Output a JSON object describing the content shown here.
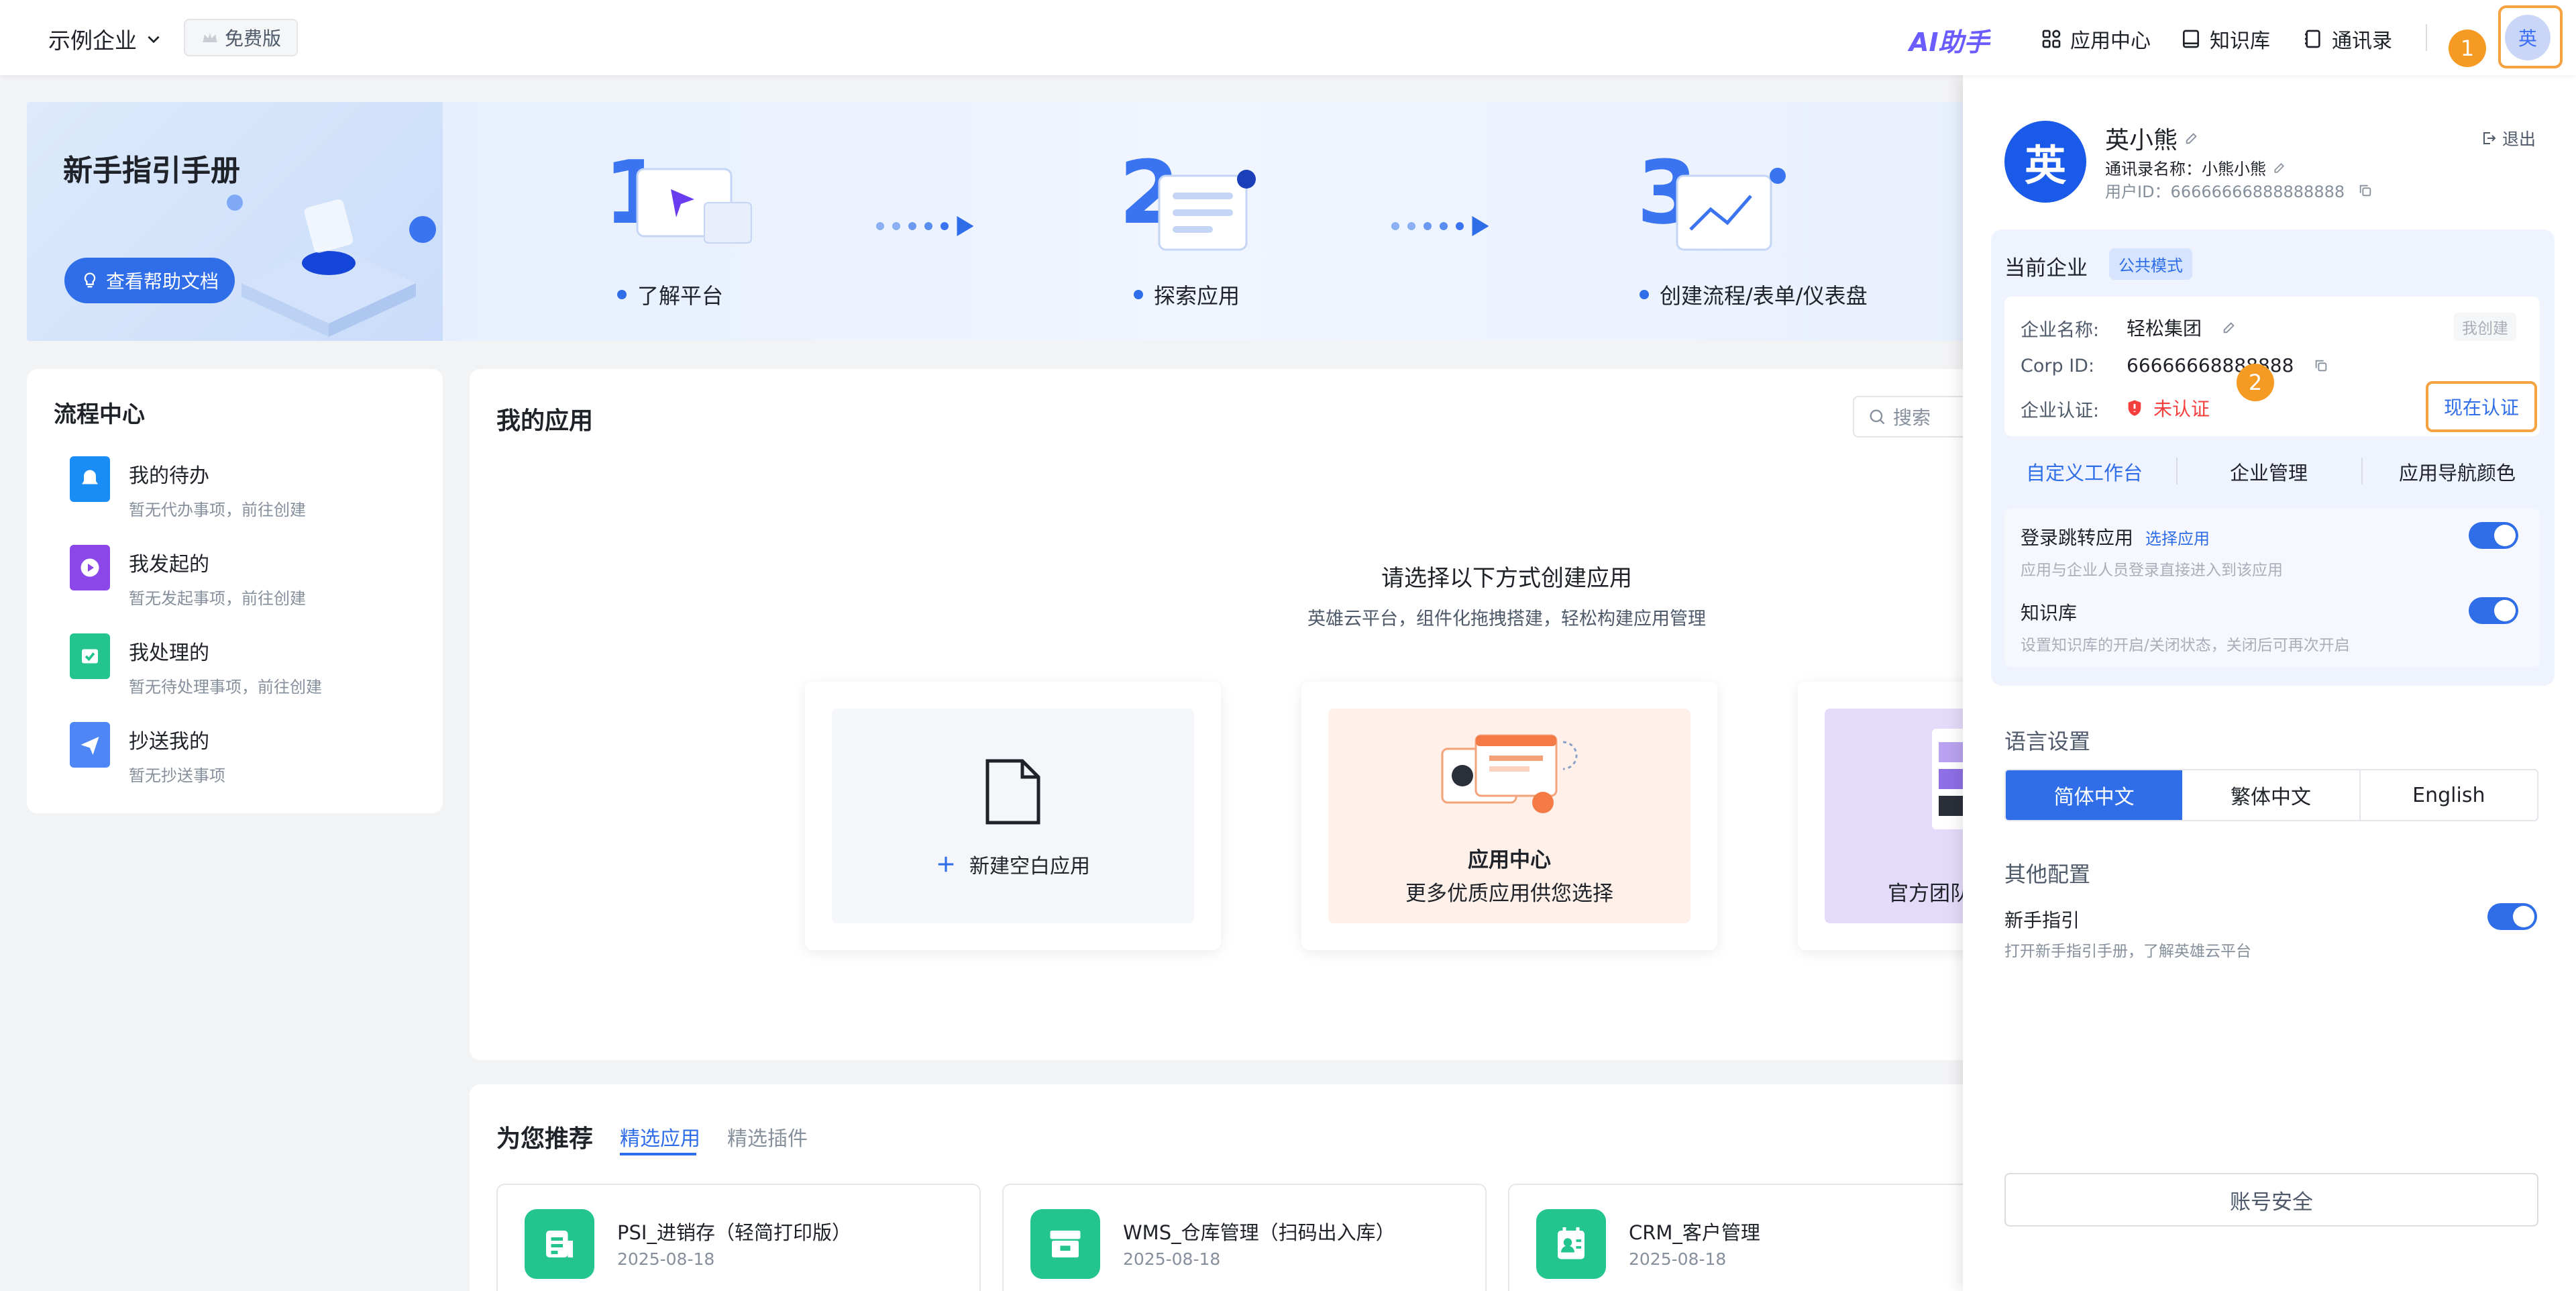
{
  "topbar": {
    "company": "示例企业",
    "plan": "免费版",
    "ai_logo": "AI助手",
    "nav": [
      {
        "label": "应用中心",
        "icon": "grid-icon"
      },
      {
        "label": "知识库",
        "icon": "book-icon"
      },
      {
        "label": "通讯录",
        "icon": "contacts-icon"
      }
    ],
    "avatar": "英",
    "badge1": "1"
  },
  "banner": {
    "title": "新手指引手册",
    "help_button": "查看帮助文档",
    "steps": [
      "了解平台",
      "探索应用",
      "创建流程/表单/仪表盘"
    ]
  },
  "flow": {
    "title": "流程中心",
    "items": [
      {
        "name": "我的待办",
        "sub": "暂无代办事项，前往创建",
        "color": "#1a8cf5",
        "icon": "bell-icon"
      },
      {
        "name": "我发起的",
        "sub": "暂无发起事项，前往创建",
        "color": "#8b47e8",
        "icon": "play-icon"
      },
      {
        "name": "我处理的",
        "sub": "暂无待处理事项，前往创建",
        "color": "#23c48e",
        "icon": "check-icon"
      },
      {
        "name": "抄送我的",
        "sub": "暂无抄送事项",
        "color": "#4f86f5",
        "icon": "send-icon"
      }
    ]
  },
  "apps": {
    "title": "我的应用",
    "search_placeholder": "搜索",
    "prompt": "请选择以下方式创建应用",
    "prompt_sub": "英雄云平台，组件化拖拽搭建，轻松构建应用管理",
    "new_blank": "新建空白应用",
    "center_title": "应用中心",
    "center_sub": "更多优质应用供您选择",
    "official": "官方团队"
  },
  "recommend": {
    "title": "为您推荐",
    "tabs": [
      "精选应用",
      "精选插件"
    ],
    "items": [
      {
        "name": "PSI_进销存（轻简打印版）",
        "date": "2025-08-18",
        "icon": "document-icon"
      },
      {
        "name": "WMS_仓库管理（扫码出入库）",
        "date": "2025-08-18",
        "icon": "box-icon"
      },
      {
        "name": "CRM_客户管理",
        "date": "2025-08-18",
        "icon": "contact-card-icon"
      }
    ]
  },
  "drawer": {
    "avatar": "英",
    "name": "英小熊",
    "logout": "退出",
    "contact_name": "通讯录名称：小熊小熊",
    "user_id": "用户ID：66666666888888888",
    "current_company": "当前企业",
    "mode_tag": "公共模式",
    "company_label": "企业名称:",
    "company_value": "轻松集团",
    "created_tag": "我创建",
    "corp_label": "Corp ID:",
    "corp_value": "66666668888888",
    "cert_label": "企业认证:",
    "cert_value": "未认证",
    "cert_button": "现在认证",
    "badge2": "2",
    "links": [
      "自定义工作台",
      "企业管理",
      "应用导航颜色"
    ],
    "login_title": "登录跳转应用",
    "login_link": "选择应用",
    "login_sub": "应用与企业人员登录直接进入到该应用",
    "kb_title": "知识库",
    "kb_sub": "设置知识库的开启/关闭状态，关闭后可再次开启",
    "lang_title": "语言设置",
    "langs": [
      "简体中文",
      "繁体中文",
      "English"
    ],
    "other_title": "其他配置",
    "guide_title": "新手指引",
    "guide_sub": "打开新手指引手册，了解英雄云平台",
    "security_button": "账号安全"
  }
}
